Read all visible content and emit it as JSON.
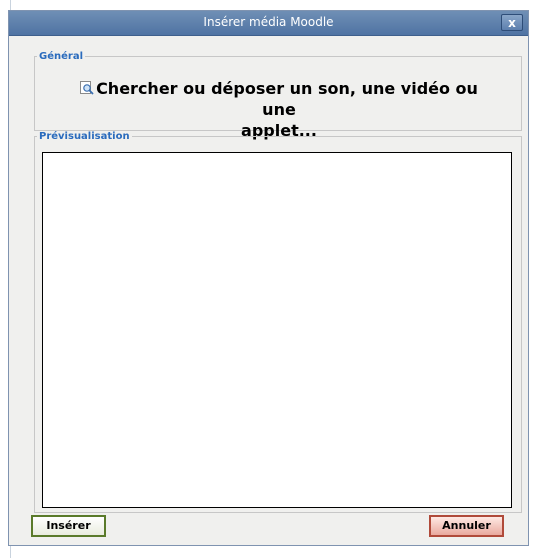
{
  "dialog": {
    "title": "Insérer média Moodle",
    "close_label": "x"
  },
  "general": {
    "legend": "Général",
    "browse_line1": "Chercher ou déposer un son, une vidéo ou une",
    "browse_line2": "applet..."
  },
  "preview": {
    "legend": "Prévisualisation"
  },
  "buttons": {
    "insert": "Insérer",
    "cancel": "Annuler"
  },
  "colors": {
    "titlebar": "#4f73a3",
    "legend": "#2a6bbd",
    "insert_border": "#5a7a2a",
    "cancel_border": "#b04a3a"
  }
}
